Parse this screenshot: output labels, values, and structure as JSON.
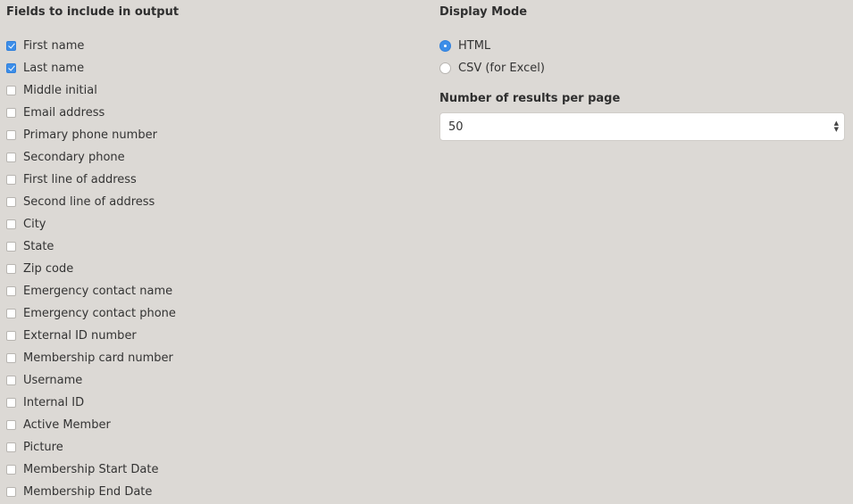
{
  "fields_section": {
    "title": "Fields to include in output",
    "items": [
      {
        "label": "First name",
        "checked": true
      },
      {
        "label": "Last name",
        "checked": true
      },
      {
        "label": "Middle initial",
        "checked": false
      },
      {
        "label": "Email address",
        "checked": false
      },
      {
        "label": "Primary phone number",
        "checked": false
      },
      {
        "label": "Secondary phone",
        "checked": false
      },
      {
        "label": "First line of address",
        "checked": false
      },
      {
        "label": "Second line of address",
        "checked": false
      },
      {
        "label": "City",
        "checked": false
      },
      {
        "label": "State",
        "checked": false
      },
      {
        "label": "Zip code",
        "checked": false
      },
      {
        "label": "Emergency contact name",
        "checked": false
      },
      {
        "label": "Emergency contact phone",
        "checked": false
      },
      {
        "label": "External ID number",
        "checked": false
      },
      {
        "label": "Membership card number",
        "checked": false
      },
      {
        "label": "Username",
        "checked": false
      },
      {
        "label": "Internal ID",
        "checked": false
      },
      {
        "label": "Active Member",
        "checked": false
      },
      {
        "label": "Picture",
        "checked": false
      },
      {
        "label": "Membership Start Date",
        "checked": false
      },
      {
        "label": "Membership End Date",
        "checked": false
      }
    ]
  },
  "display_mode": {
    "title": "Display Mode",
    "options": [
      {
        "label": "HTML",
        "selected": true
      },
      {
        "label": "CSV (for Excel)",
        "selected": false
      }
    ]
  },
  "results_per_page": {
    "title": "Number of results per page",
    "value": "50",
    "arrow_icon": "updown-select-arrows-icon"
  },
  "colors": {
    "background": "#dcd9d5",
    "accent": "#3d8ee8"
  }
}
